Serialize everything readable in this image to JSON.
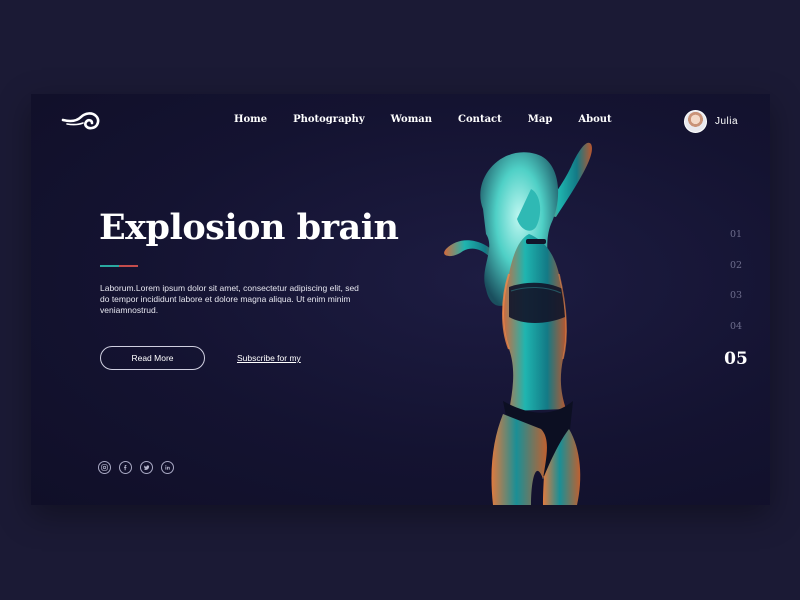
{
  "nav": {
    "items": [
      {
        "label": "Home"
      },
      {
        "label": "Photography"
      },
      {
        "label": "Woman"
      },
      {
        "label": "Contact"
      },
      {
        "label": "Map"
      },
      {
        "label": "About"
      }
    ]
  },
  "user": {
    "name": "Julia"
  },
  "hero": {
    "title": "Explosion brain",
    "description": "Laborum.Lorem ipsum dolor sit amet, consectetur adipiscing elit, sed do tempor incididunt labore et dolore magna aliqua. Ut enim  minim veniamnostrud.",
    "read_more": "Read More",
    "subscribe": "Subscribe for my",
    "accent_colors": [
      "#2aa8a0",
      "#c44c4c"
    ]
  },
  "socials": [
    {
      "icon": "instagram-icon"
    },
    {
      "icon": "facebook-icon"
    },
    {
      "icon": "twitter-icon"
    },
    {
      "icon": "linkedin-icon"
    }
  ],
  "pagination": {
    "pages": [
      "01",
      "02",
      "03",
      "04",
      "05"
    ],
    "active": "05"
  },
  "theme": {
    "page_background": "#1b1a35",
    "card_background": "#141331",
    "text": "#ffffff",
    "muted": "#6d6d8c"
  }
}
